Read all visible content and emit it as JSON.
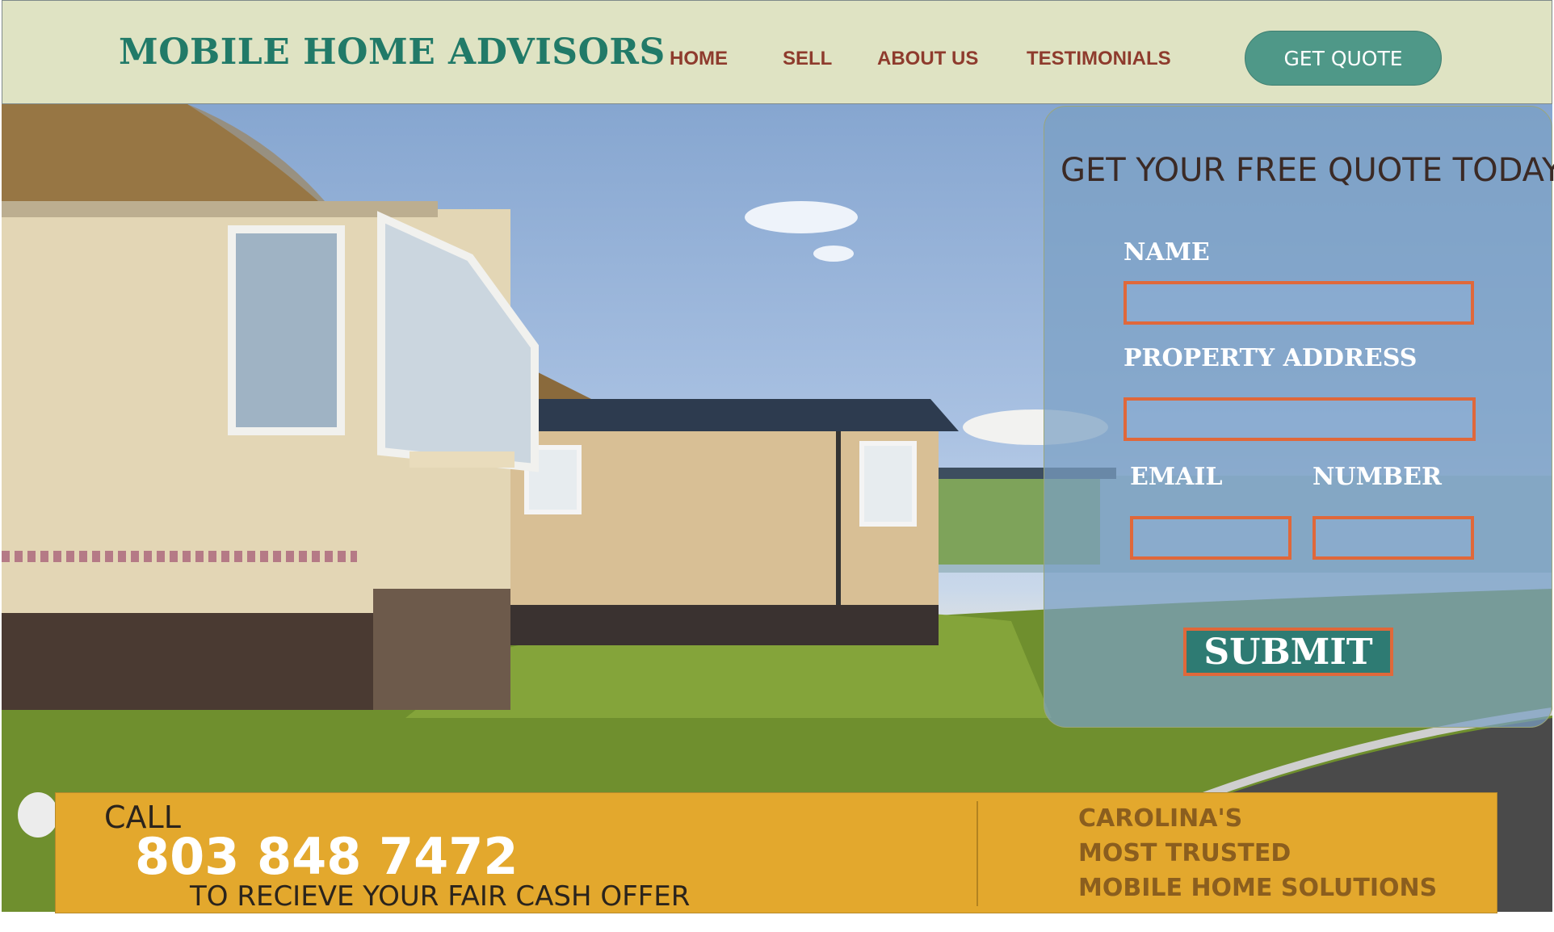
{
  "header": {
    "brand": "MOBILE HOME ADVISORS",
    "nav": [
      "HOME",
      "SELL",
      "ABOUT US",
      "TESTIMONIALS"
    ],
    "cta": "GET QUOTE"
  },
  "form": {
    "title": "GET YOUR FREE QUOTE TODAY",
    "fields": {
      "name": {
        "label": "NAME",
        "value": "",
        "placeholder": ""
      },
      "address": {
        "label": "PROPERTY ADDRESS",
        "value": "",
        "placeholder": ""
      },
      "email": {
        "label": "EMAIL",
        "value": "",
        "placeholder": ""
      },
      "number": {
        "label": "NUMBER",
        "value": "",
        "placeholder": ""
      }
    },
    "submit": "SUBMIT"
  },
  "banner": {
    "call": "CALL",
    "phone": "803 848 7472",
    "offer": "TO RECIEVE YOUR FAIR CASH OFFER",
    "tagline": [
      "CAROLINA'S",
      "MOST TRUSTED",
      "MOBILE HOME SOLUTIONS"
    ]
  },
  "colors": {
    "header_bg": "#dfe3c3",
    "brand": "#217a68",
    "nav": "#8e3b2d",
    "cta_bg": "#4f9888",
    "input_border": "#e0683a",
    "banner_bg": "#e3a82d"
  }
}
